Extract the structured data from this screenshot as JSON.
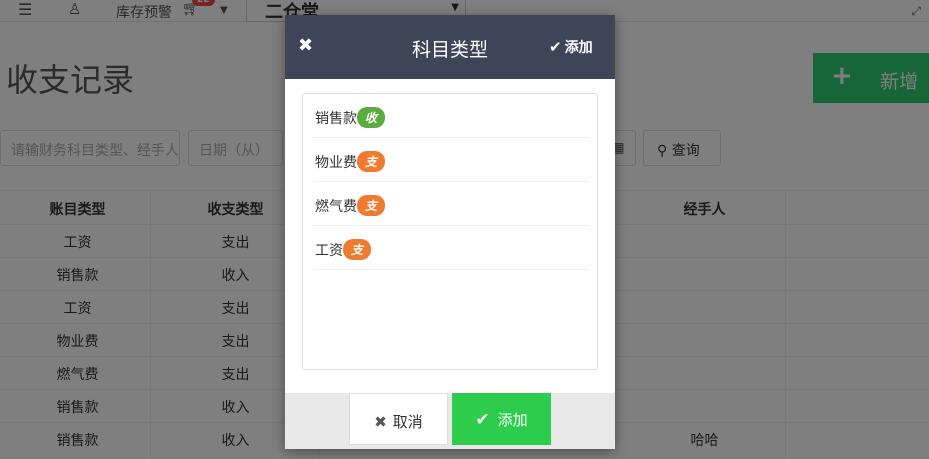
{
  "colors": {
    "header_bg": "#3f4558",
    "income_tag": "#5cab3e",
    "expense_tag": "#ef7a30",
    "confirm_button": "#2ecc4c",
    "new_button": "#2ecc71",
    "overlay": "rgba(0,0,0,0.5)"
  },
  "topbar": {
    "menu_icon": "hamburger-icon",
    "user_icon": "user-icon",
    "stock_alert_label": "库存预警",
    "cart_icon": "cart-icon",
    "store_name": "二仓堂",
    "expand_icon": "expand-icon"
  },
  "page": {
    "title": "收支记录",
    "new_button_label": "新增",
    "search_placeholder": "请输财务科目类型、经手人",
    "date_from_placeholder": "日期（从）",
    "query_label": "查询",
    "table": {
      "headers": [
        "账目类型",
        "收支类型",
        "经手人"
      ],
      "rows": [
        {
          "account": "工资",
          "type": "支出",
          "handler": ""
        },
        {
          "account": "销售款",
          "type": "收入",
          "handler": ""
        },
        {
          "account": "工资",
          "type": "支出",
          "handler": ""
        },
        {
          "account": "物业费",
          "type": "支出",
          "handler": ""
        },
        {
          "account": "燃气费",
          "type": "支出",
          "handler": ""
        },
        {
          "account": "销售款",
          "type": "收入",
          "handler": ""
        },
        {
          "account": "销售款",
          "type": "收入",
          "handler": "哈哈"
        }
      ]
    }
  },
  "modal": {
    "title": "科目类型",
    "close_icon": "close-icon",
    "header_add_label": "添加",
    "items": [
      {
        "name": "销售款",
        "tag": "收",
        "kind": "income"
      },
      {
        "name": "物业费",
        "tag": "支",
        "kind": "expense"
      },
      {
        "name": "燃气费",
        "tag": "支",
        "kind": "expense"
      },
      {
        "name": "工资",
        "tag": "支",
        "kind": "expense"
      }
    ],
    "cancel_label": "取消",
    "confirm_label": "添加"
  }
}
